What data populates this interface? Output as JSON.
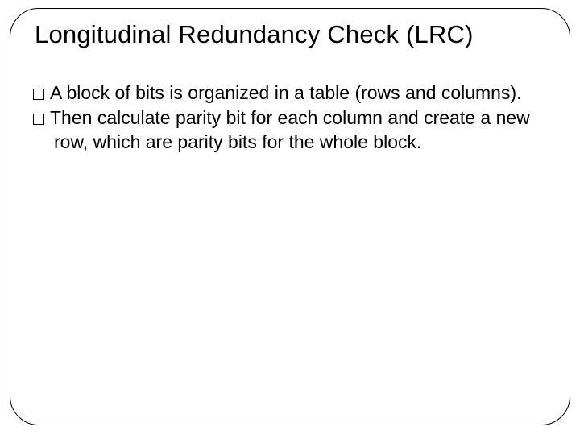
{
  "title": "Longitudinal Redundancy Check (LRC)",
  "bullets": [
    "A block of bits is organized in a table (rows and columns).",
    "Then calculate parity bit for each column and create a new row, which are parity bits for the whole block."
  ]
}
